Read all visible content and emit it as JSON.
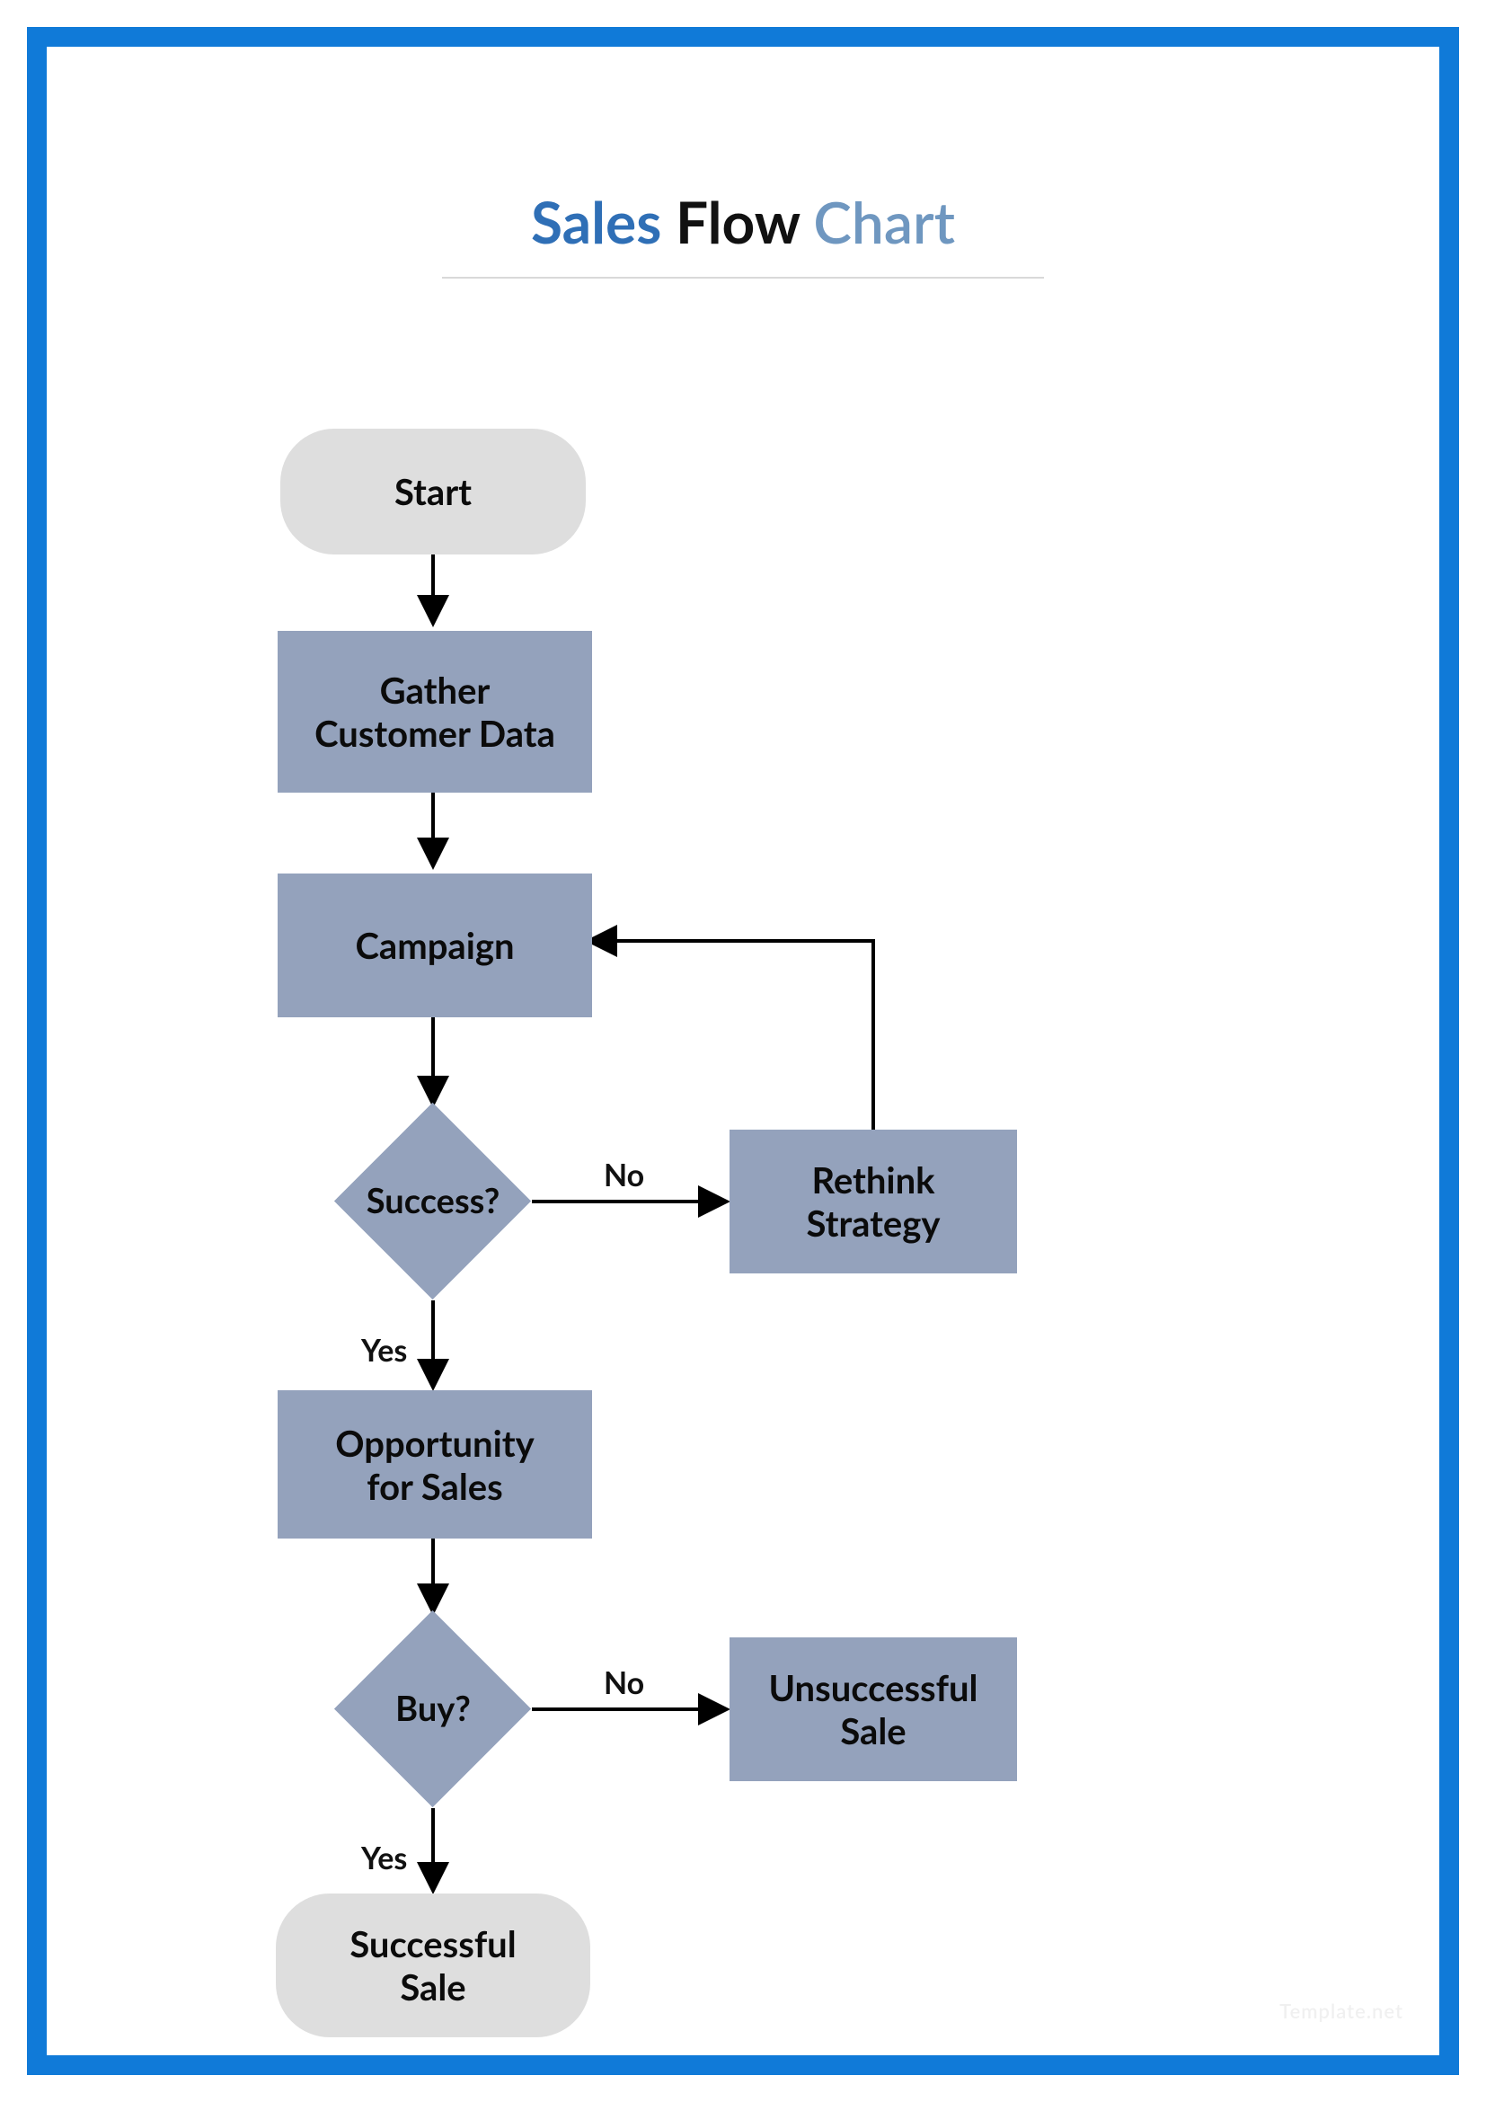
{
  "title": {
    "w1": "Sales",
    "w2": "Flow",
    "w3": "Chart"
  },
  "nodes": {
    "start": {
      "label": "Start"
    },
    "gather": {
      "label": "Gather\nCustomer Data"
    },
    "campaign": {
      "label": "Campaign"
    },
    "success": {
      "label": "Success?"
    },
    "rethink": {
      "label": "Rethink\nStrategy"
    },
    "opportunity": {
      "label": "Opportunity\nfor Sales"
    },
    "buy": {
      "label": "Buy?"
    },
    "unsuccessful": {
      "label": "Unsuccessful\nSale"
    },
    "successful": {
      "label": "Successful\nSale"
    }
  },
  "labels": {
    "success_no": "No",
    "success_yes": "Yes",
    "buy_no": "No",
    "buy_yes": "Yes"
  },
  "watermark": "Template.net",
  "chart_data": {
    "type": "flowchart",
    "title": "Sales Flow Chart",
    "nodes": [
      {
        "id": "start",
        "kind": "terminator",
        "text": "Start"
      },
      {
        "id": "gather",
        "kind": "process",
        "text": "Gather Customer Data"
      },
      {
        "id": "campaign",
        "kind": "process",
        "text": "Campaign"
      },
      {
        "id": "success",
        "kind": "decision",
        "text": "Success?"
      },
      {
        "id": "rethink",
        "kind": "process",
        "text": "Rethink Strategy"
      },
      {
        "id": "opportunity",
        "kind": "process",
        "text": "Opportunity for Sales"
      },
      {
        "id": "buy",
        "kind": "decision",
        "text": "Buy?"
      },
      {
        "id": "unsuccessful",
        "kind": "process",
        "text": "Unsuccessful Sale"
      },
      {
        "id": "successful",
        "kind": "terminator",
        "text": "Successful Sale"
      }
    ],
    "edges": [
      {
        "from": "start",
        "to": "gather",
        "label": ""
      },
      {
        "from": "gather",
        "to": "campaign",
        "label": ""
      },
      {
        "from": "campaign",
        "to": "success",
        "label": ""
      },
      {
        "from": "success",
        "to": "rethink",
        "label": "No"
      },
      {
        "from": "rethink",
        "to": "campaign",
        "label": ""
      },
      {
        "from": "success",
        "to": "opportunity",
        "label": "Yes"
      },
      {
        "from": "opportunity",
        "to": "buy",
        "label": ""
      },
      {
        "from": "buy",
        "to": "unsuccessful",
        "label": "No"
      },
      {
        "from": "buy",
        "to": "successful",
        "label": "Yes"
      }
    ]
  }
}
